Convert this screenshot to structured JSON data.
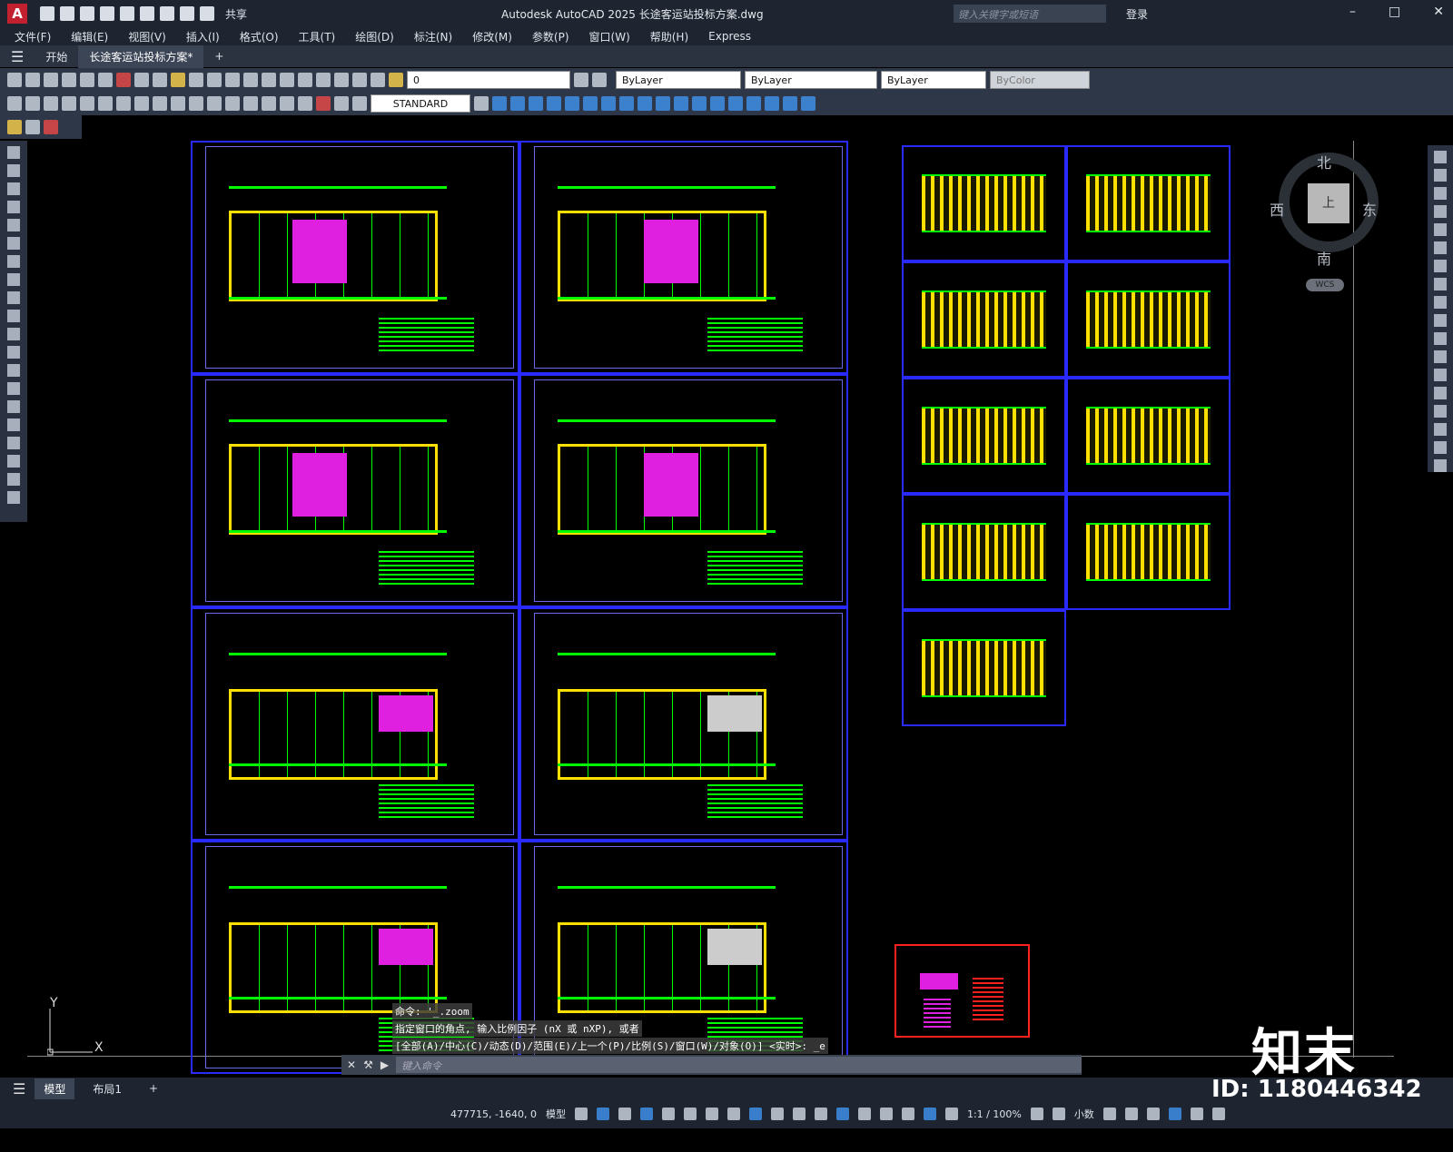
{
  "titlebar": {
    "app_icon": "A",
    "share": "共享",
    "title": "Autodesk AutoCAD 2025    长途客运站投标方案.dwg",
    "search_placeholder": "键入关键字或短语",
    "login": "登录"
  },
  "menu": [
    "文件(F)",
    "编辑(E)",
    "视图(V)",
    "插入(I)",
    "格式(O)",
    "工具(T)",
    "绘图(D)",
    "标注(N)",
    "修改(M)",
    "参数(P)",
    "窗口(W)",
    "帮助(H)",
    "Express"
  ],
  "tabs": {
    "start": "开始",
    "doc": "长途客运站投标方案*",
    "add": "+"
  },
  "props": {
    "layer": "0",
    "color": "ByLayer",
    "linetype": "ByLayer",
    "lineweight": "ByLayer",
    "plotstyle": "ByColor",
    "textstyle": "STANDARD"
  },
  "viewcube": {
    "north": "北",
    "south": "南",
    "east": "东",
    "west": "西",
    "face": "上",
    "wcs": "WCS"
  },
  "ucs": {
    "x": "X",
    "y": "Y"
  },
  "command": {
    "history": [
      "命令: '_.zoom",
      "指定窗口的角点, 输入比例因子 (nX 或 nXP), 或者",
      "[全部(A)/中心(C)/动态(D)/范围(E)/上一个(P)/比例(S)/窗口(W)/对象(O)] <实时>: _e"
    ],
    "placeholder": "键入命令"
  },
  "layout_tabs": {
    "model": "模型",
    "layout1": "布局1",
    "add": "+"
  },
  "status": {
    "coords": "477715, -1640, 0",
    "space": "模型",
    "scale": "1:1 / 100%",
    "units": "小数"
  },
  "watermark": {
    "brand": "知末",
    "id": "ID: 1180446342"
  }
}
